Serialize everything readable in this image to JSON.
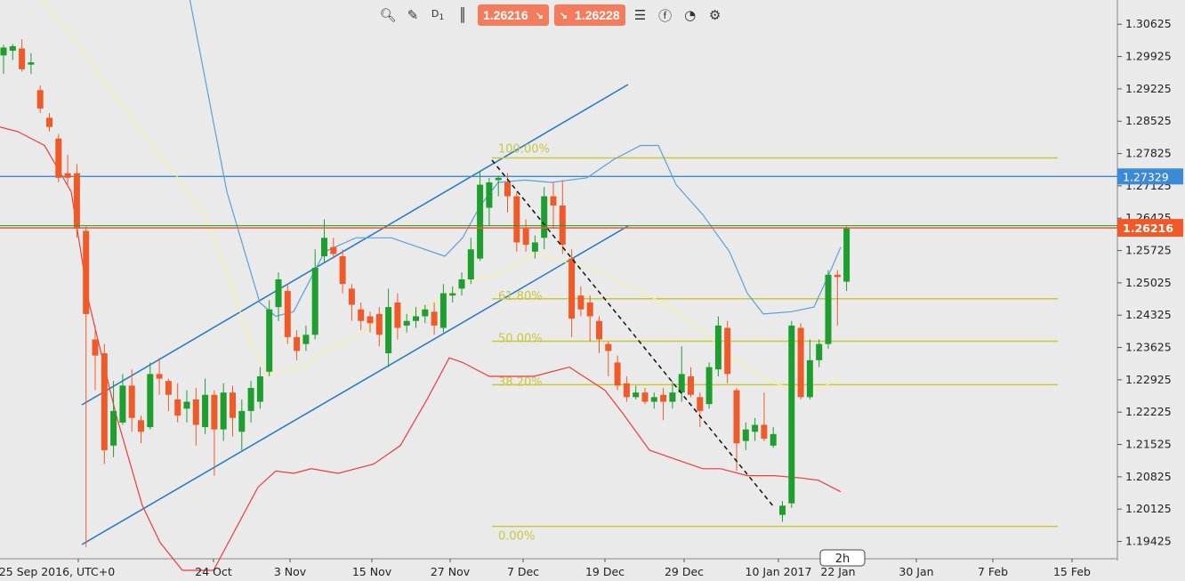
{
  "toolbar": {
    "zoom_icon": "zoom-icon",
    "draw_icon": "drawing-tools-icon",
    "timeframe_label": "D",
    "timeframe_num": "1",
    "candle_icon": "candle-type-icon",
    "sell_price": "1.26216",
    "buy_price": "1.26228",
    "list_icon": "list-icon",
    "facebook_icon": "facebook-icon",
    "user_icon": "user-icon",
    "settings_icon": "settings-icon"
  },
  "colors": {
    "background": "#eaeaea",
    "bull": "#1e9e2e",
    "bear": "#f05a28",
    "upper_band": "#5aa0dc",
    "middle_band": "#f7f29a",
    "lower_band": "#ee3b3b",
    "channel": "#1f78c8",
    "fib": "#c8c83c",
    "current_price": "#f05a28",
    "level_line": "#3a8ad6"
  },
  "chart_data": {
    "type": "candlestick",
    "title": "",
    "xlabel": "",
    "ylabel": "",
    "ylim": [
      1.1905,
      1.3115
    ],
    "y_ticks": [
      "1.30625",
      "1.29925",
      "1.29225",
      "1.28525",
      "1.27825",
      "1.27125",
      "1.26425",
      "1.25725",
      "1.25025",
      "1.24325",
      "1.23625",
      "1.22925",
      "1.22225",
      "1.21525",
      "1.20825",
      "1.20125",
      "1.19425"
    ],
    "x_ticks": [
      "25 Sep 2016, UTC+0",
      "24 Oct",
      "3 Nov",
      "15 Nov",
      "27 Nov",
      "7 Dec",
      "19 Dec",
      "29 Dec",
      "10 Jan 2017",
      "22 Jan",
      "30 Jan",
      "7 Feb",
      "15 Feb"
    ],
    "timeframe_marker": "2h",
    "current_price": "1.26216",
    "level_price": "1.27329",
    "candles": [
      [
        1.2995,
        1.3012,
        1.2955,
        1.3018
      ],
      [
        1.3005,
        1.3015,
        1.2985,
        1.302
      ],
      [
        1.301,
        1.2965,
        1.296,
        1.303
      ],
      [
        1.2975,
        1.298,
        1.2955,
        1.3
      ],
      [
        1.292,
        1.288,
        1.287,
        1.293
      ],
      [
        1.286,
        1.284,
        1.283,
        1.287
      ],
      [
        1.2815,
        1.273,
        1.272,
        1.2825
      ],
      [
        1.274,
        1.273,
        1.2715,
        1.278
      ],
      [
        1.274,
        1.262,
        1.26,
        1.276
      ],
      [
        1.2615,
        1.2435,
        1.193,
        1.2625
      ],
      [
        1.238,
        1.2345,
        1.227,
        1.241
      ],
      [
        1.235,
        1.214,
        1.211,
        1.237
      ],
      [
        1.215,
        1.2225,
        1.2125,
        1.229
      ],
      [
        1.22,
        1.228,
        1.2195,
        1.2305
      ],
      [
        1.228,
        1.221,
        1.218,
        1.2315
      ],
      [
        1.2205,
        1.218,
        1.2155,
        1.2215
      ],
      [
        1.219,
        1.2305,
        1.2185,
        1.233
      ],
      [
        1.2305,
        1.2295,
        1.226,
        1.234
      ],
      [
        1.229,
        1.226,
        1.2225,
        1.2295
      ],
      [
        1.225,
        1.2215,
        1.22,
        1.2285
      ],
      [
        1.223,
        1.2245,
        1.22,
        1.227
      ],
      [
        1.225,
        1.2195,
        1.215,
        1.2275
      ],
      [
        1.219,
        1.226,
        1.2175,
        1.2295
      ],
      [
        1.226,
        1.2185,
        1.2085,
        1.227
      ],
      [
        1.2185,
        1.2265,
        1.216,
        1.2285
      ],
      [
        1.2265,
        1.221,
        1.217,
        1.228
      ],
      [
        1.218,
        1.2225,
        1.214,
        1.225
      ],
      [
        1.2225,
        1.2275,
        1.22,
        1.229
      ],
      [
        1.2245,
        1.23,
        1.223,
        1.232
      ],
      [
        1.231,
        1.2445,
        1.23,
        1.2465
      ],
      [
        1.245,
        1.251,
        1.242,
        1.2525
      ],
      [
        1.2485,
        1.2385,
        1.237,
        1.25
      ],
      [
        1.2385,
        1.2355,
        1.2335,
        1.24
      ],
      [
        1.237,
        1.239,
        1.2355,
        1.241
      ],
      [
        1.239,
        1.2535,
        1.238,
        1.2575
      ],
      [
        1.256,
        1.26,
        1.2545,
        1.264
      ],
      [
        1.258,
        1.2565,
        1.2555,
        1.26
      ],
      [
        1.256,
        1.25,
        1.248,
        1.2575
      ],
      [
        1.249,
        1.2455,
        1.242,
        1.25
      ],
      [
        1.2445,
        1.242,
        1.24,
        1.246
      ],
      [
        1.243,
        1.2415,
        1.2395,
        1.244
      ],
      [
        1.2435,
        1.239,
        1.2365,
        1.245
      ],
      [
        1.235,
        1.245,
        1.232,
        1.249
      ],
      [
        1.246,
        1.2405,
        1.238,
        1.248
      ],
      [
        1.241,
        1.242,
        1.2395,
        1.2435
      ],
      [
        1.242,
        1.243,
        1.2405,
        1.245
      ],
      [
        1.243,
        1.2445,
        1.2415,
        1.2455
      ],
      [
        1.244,
        1.241,
        1.239,
        1.246
      ],
      [
        1.2405,
        1.248,
        1.2395,
        1.25
      ],
      [
        1.2475,
        1.248,
        1.246,
        1.2495
      ],
      [
        1.249,
        1.251,
        1.2475,
        1.2525
      ],
      [
        1.251,
        1.2575,
        1.25,
        1.26
      ],
      [
        1.2555,
        1.2715,
        1.255,
        1.2745
      ],
      [
        1.2665,
        1.272,
        1.2625,
        1.273
      ],
      [
        1.2725,
        1.273,
        1.269,
        1.2735
      ],
      [
        1.272,
        1.269,
        1.2655,
        1.274
      ],
      [
        1.269,
        1.259,
        1.257,
        1.27
      ],
      [
        1.262,
        1.2585,
        1.257,
        1.264
      ],
      [
        1.257,
        1.259,
        1.2555,
        1.2605
      ],
      [
        1.26,
        1.269,
        1.2575,
        1.271
      ],
      [
        1.269,
        1.267,
        1.262,
        1.272
      ],
      [
        1.267,
        1.2585,
        1.2565,
        1.2725
      ],
      [
        1.2555,
        1.2425,
        1.2385,
        1.2575
      ],
      [
        1.2475,
        1.2445,
        1.243,
        1.2495
      ],
      [
        1.246,
        1.243,
        1.2375,
        1.2475
      ],
      [
        1.242,
        1.238,
        1.235,
        1.243
      ],
      [
        1.237,
        1.2355,
        1.23,
        1.2375
      ],
      [
        1.233,
        1.228,
        1.227,
        1.2345
      ],
      [
        1.2285,
        1.2255,
        1.2245,
        1.23
      ],
      [
        1.2255,
        1.2265,
        1.225,
        1.228
      ],
      [
        1.2265,
        1.2245,
        1.224,
        1.2275
      ],
      [
        1.2245,
        1.2255,
        1.223,
        1.2265
      ],
      [
        1.226,
        1.2245,
        1.2205,
        1.2275
      ],
      [
        1.2245,
        1.2265,
        1.223,
        1.229
      ],
      [
        1.2265,
        1.2305,
        1.2245,
        1.2365
      ],
      [
        1.23,
        1.226,
        1.2255,
        1.232
      ],
      [
        1.2255,
        1.2225,
        1.219,
        1.2265
      ],
      [
        1.224,
        1.232,
        1.223,
        1.233
      ],
      [
        1.2315,
        1.241,
        1.23,
        1.243
      ],
      [
        1.2405,
        1.2305,
        1.2285,
        1.242
      ],
      [
        1.227,
        1.2155,
        1.2095,
        1.2275
      ],
      [
        1.216,
        1.2185,
        1.214,
        1.22
      ],
      [
        1.218,
        1.2195,
        1.216,
        1.221
      ],
      [
        1.2195,
        1.2165,
        1.216,
        1.2265
      ],
      [
        1.215,
        1.2175,
        1.2145,
        1.219
      ],
      [
        1.2,
        1.202,
        1.1985,
        1.203
      ],
      [
        1.2025,
        1.241,
        1.2015,
        1.242
      ],
      [
        1.2405,
        1.2255,
        1.225,
        1.2415
      ],
      [
        1.2255,
        1.2335,
        1.225,
        1.238
      ],
      [
        1.2335,
        1.237,
        1.232,
        1.238
      ],
      [
        1.237,
        1.252,
        1.236,
        1.253
      ],
      [
        1.252,
        1.2515,
        1.241,
        1.253
      ],
      [
        1.2505,
        1.2621,
        1.2485,
        1.2625
      ]
    ],
    "upper_band": [
      [
        0,
        1.322
      ],
      [
        100,
        1.321
      ],
      [
        152,
        1.328
      ],
      [
        205,
        1.32
      ],
      [
        255,
        1.27
      ],
      [
        292,
        1.246
      ],
      [
        310,
        1.243
      ],
      [
        330,
        1.244
      ],
      [
        365,
        1.257
      ],
      [
        400,
        1.26
      ],
      [
        440,
        1.26
      ],
      [
        470,
        1.258
      ],
      [
        500,
        1.256
      ],
      [
        520,
        1.26
      ],
      [
        540,
        1.267
      ],
      [
        560,
        1.272
      ],
      [
        590,
        1.2725
      ],
      [
        620,
        1.272
      ],
      [
        660,
        1.273
      ],
      [
        690,
        1.277
      ],
      [
        720,
        1.28
      ],
      [
        740,
        1.28
      ],
      [
        760,
        1.2715
      ],
      [
        790,
        1.265
      ],
      [
        820,
        1.257
      ],
      [
        840,
        1.248
      ],
      [
        858,
        1.2435
      ],
      [
        890,
        1.244
      ],
      [
        915,
        1.245
      ],
      [
        935,
        1.2535
      ],
      [
        945,
        1.258
      ]
    ],
    "middle_band": [
      [
        0,
        1.32
      ],
      [
        40,
        1.313
      ],
      [
        80,
        1.304
      ],
      [
        120,
        1.293
      ],
      [
        160,
        1.283
      ],
      [
        200,
        1.273
      ],
      [
        230,
        1.265
      ],
      [
        260,
        1.25
      ],
      [
        280,
        1.238
      ],
      [
        300,
        1.2305
      ],
      [
        340,
        1.232
      ],
      [
        370,
        1.236
      ],
      [
        400,
        1.2385
      ],
      [
        420,
        1.2415
      ],
      [
        450,
        1.243
      ],
      [
        480,
        1.245
      ],
      [
        520,
        1.25
      ],
      [
        560,
        1.252
      ],
      [
        600,
        1.2565
      ],
      [
        640,
        1.2545
      ],
      [
        670,
        1.253
      ],
      [
        700,
        1.25
      ],
      [
        730,
        1.2475
      ],
      [
        760,
        1.244
      ],
      [
        790,
        1.24
      ],
      [
        815,
        1.235
      ],
      [
        840,
        1.232
      ],
      [
        870,
        1.2285
      ],
      [
        900,
        1.227
      ],
      [
        920,
        1.227
      ],
      [
        945,
        1.23
      ]
    ],
    "lower_band": [
      [
        0,
        1.284
      ],
      [
        20,
        1.283
      ],
      [
        50,
        1.28
      ],
      [
        80,
        1.27
      ],
      [
        100,
        1.246
      ],
      [
        130,
        1.222
      ],
      [
        160,
        1.202
      ],
      [
        180,
        1.194
      ],
      [
        205,
        1.188
      ],
      [
        240,
        1.188
      ],
      [
        265,
        1.197
      ],
      [
        290,
        1.206
      ],
      [
        310,
        1.2095
      ],
      [
        330,
        1.209
      ],
      [
        350,
        1.21
      ],
      [
        380,
        1.209
      ],
      [
        420,
        1.211
      ],
      [
        450,
        1.215
      ],
      [
        480,
        1.225
      ],
      [
        505,
        1.234
      ],
      [
        520,
        1.233
      ],
      [
        550,
        1.23
      ],
      [
        600,
        1.23
      ],
      [
        640,
        1.232
      ],
      [
        680,
        1.227
      ],
      [
        700,
        1.222
      ],
      [
        730,
        1.214
      ],
      [
        760,
        1.212
      ],
      [
        790,
        1.21
      ],
      [
        810,
        1.21
      ],
      [
        840,
        1.2085
      ],
      [
        870,
        1.2085
      ],
      [
        900,
        1.208
      ],
      [
        920,
        1.2075
      ],
      [
        945,
        1.205
      ]
    ],
    "fib": [
      {
        "label": "100.00%",
        "price": 1.2773
      },
      {
        "label": "61.80%",
        "price": 1.2468
      },
      {
        "label": "50.00%",
        "price": 1.2376
      },
      {
        "label": "38.20%",
        "price": 1.2282
      },
      {
        "label": "0.00%",
        "price": 1.1975
      }
    ]
  }
}
